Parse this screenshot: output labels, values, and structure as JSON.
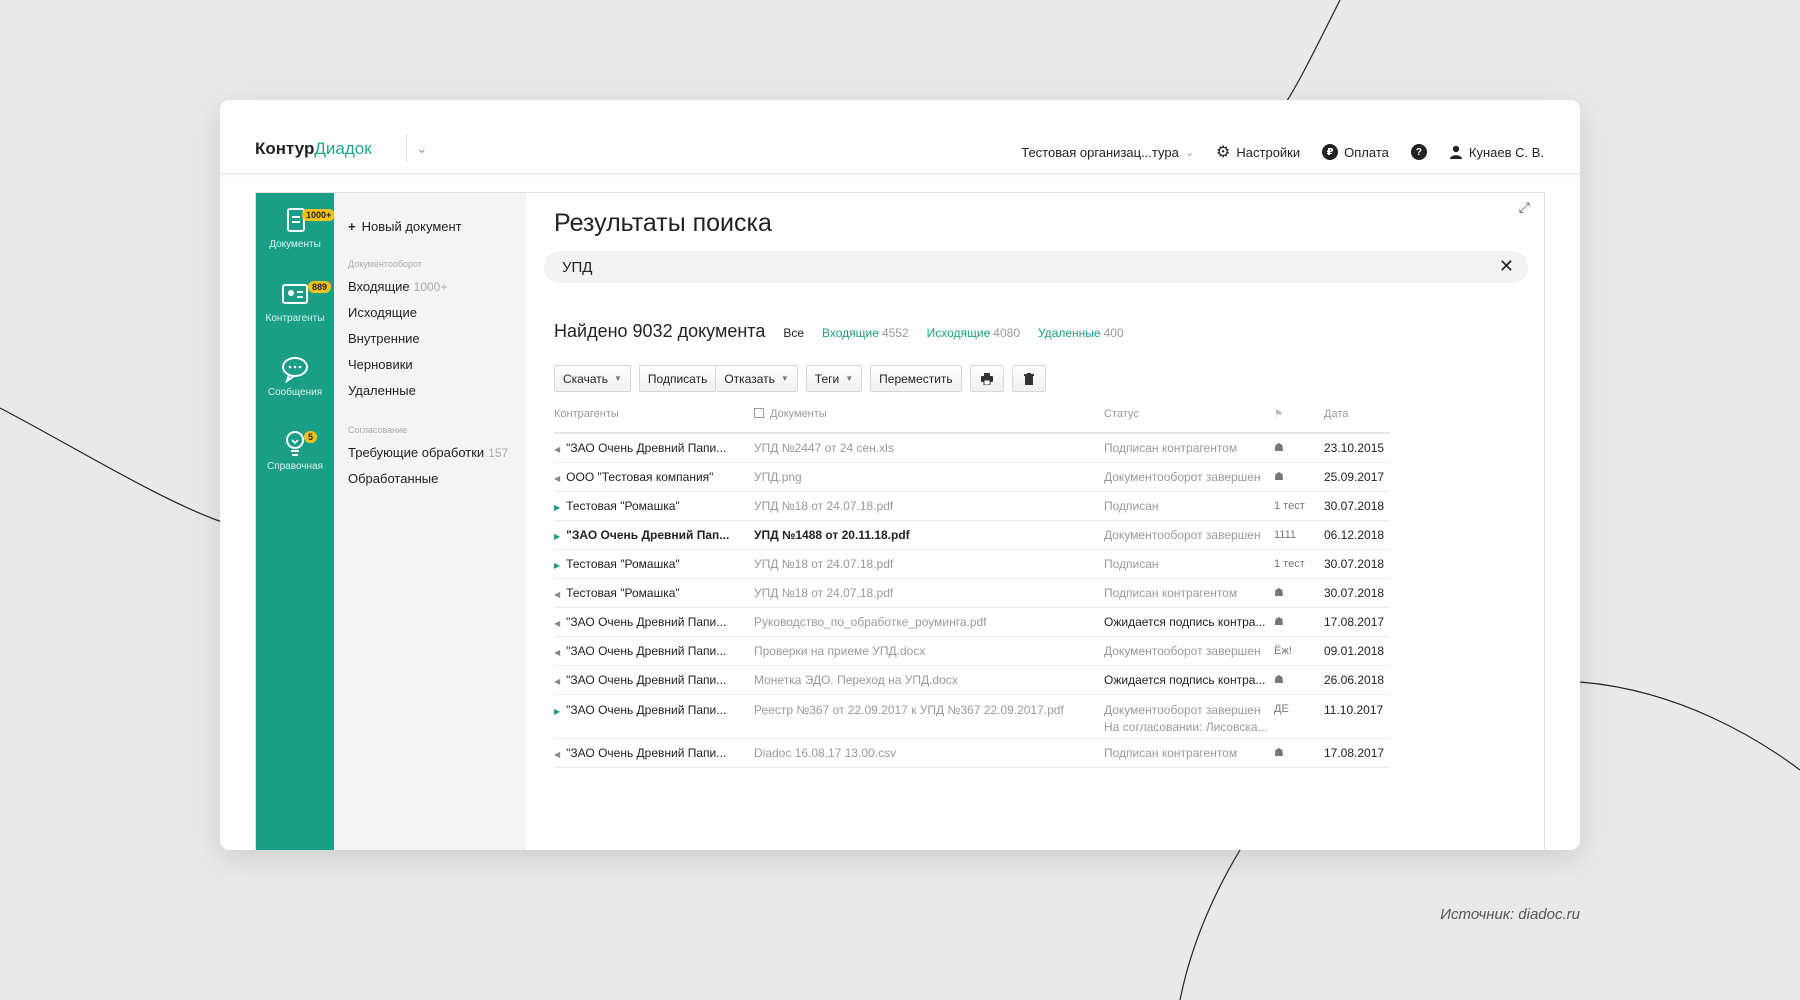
{
  "source_note": "Источник: diadoc.ru",
  "header": {
    "logo_part1": "Контур",
    "logo_part2": "Диадок",
    "organization": "Тестовая организац...тура",
    "settings": "Настройки",
    "payment": "Оплата",
    "help_glyph": "?",
    "user": "Кунаев С. В."
  },
  "rail": [
    {
      "label": "Документы",
      "badge": "1000+",
      "icon": "document-icon"
    },
    {
      "label": "Контрагенты",
      "badge": "889",
      "icon": "contacts-icon"
    },
    {
      "label": "Сообщения",
      "badge": "",
      "icon": "chat-icon"
    },
    {
      "label": "Справочная",
      "badge": "5",
      "icon": "lightbulb-icon"
    }
  ],
  "nav": {
    "new_document": "Новый документ",
    "section_docflow": "Документооборот",
    "items": [
      {
        "label": "Входящие",
        "count": "1000+"
      },
      {
        "label": "Исходящие",
        "count": ""
      },
      {
        "label": "Внутренние",
        "count": ""
      },
      {
        "label": "Черновики",
        "count": ""
      },
      {
        "label": "Удаленные",
        "count": ""
      }
    ],
    "section_approval": "Согласование",
    "approval_items": [
      {
        "label": "Требующие обработки",
        "count": "157"
      },
      {
        "label": "Обработанные",
        "count": ""
      }
    ]
  },
  "main": {
    "title": "Результаты поиска",
    "search_value": "УПД",
    "clear_glyph": "✕",
    "found": "Найдено 9032 документа",
    "filters": [
      {
        "label": "Все",
        "count": ""
      },
      {
        "label": "Входящие",
        "count": "4552"
      },
      {
        "label": "Исходящие",
        "count": "4080"
      },
      {
        "label": "Удаленные",
        "count": "400"
      }
    ],
    "toolbar": {
      "download": "Скачать",
      "sign": "Подписать",
      "reject": "Отказать",
      "tags": "Теги",
      "move": "Переместить",
      "print_icon": "printer-icon",
      "delete_icon": "trash-icon"
    },
    "columns": {
      "party": "Контрагенты",
      "docs": "Документы",
      "status": "Статус",
      "tags_icon": "tag-icon",
      "date": "Дата"
    },
    "rows": [
      {
        "party": "\"ЗАО Очень Древний Папи...",
        "doc": "УПД №2447 от 24 сен.xls",
        "status": "Подписан контрагентом",
        "tag": "☗",
        "date": "23.10.2015"
      },
      {
        "party": "ООО \"Тестовая компания\"",
        "doc": "УПД.png",
        "status": "Документооборот завершен",
        "tag": "☗",
        "date": "25.09.2017"
      },
      {
        "party": "Тестовая \"Ромашка\"",
        "doc": "УПД №18 от 24.07.18.pdf",
        "status": "Подписан",
        "tag": "1 тест",
        "date": "30.07.2018"
      },
      {
        "party": "\"ЗАО Очень Древний Пап...",
        "doc": "УПД №1488 от 20.11.18.pdf",
        "status": "Документооборот завершен",
        "tag": "1111",
        "date": "06.12.2018"
      },
      {
        "party": "Тестовая \"Ромашка\"",
        "doc": "УПД №18 от 24.07.18.pdf",
        "status": "Подписан",
        "tag": "1 тест",
        "date": "30.07.2018"
      },
      {
        "party": "Тестовая \"Ромашка\"",
        "doc": "УПД №18 от 24.07.18.pdf",
        "status": "Подписан контрагентом",
        "tag": "☗",
        "date": "30.07.2018"
      },
      {
        "party": "\"ЗАО Очень Древний Папи...",
        "doc": "Руководство_по_обработке_роуминга.pdf",
        "status": "Ожидается подпись контра...",
        "tag": "☗",
        "date": "17.08.2017"
      },
      {
        "party": "\"ЗАО Очень Древний Папи...",
        "doc": "Проверки на приеме УПД.docx",
        "status": "Документооборот завершен",
        "tag": "Ёж!",
        "date": "09.01.2018"
      },
      {
        "party": "\"ЗАО Очень Древний Папи...",
        "doc": "Монетка ЭДО. Переход на УПД.docx",
        "status": "Ожидается подпись контра...",
        "tag": "☗",
        "date": "26.06.2018"
      },
      {
        "party": "\"ЗАО Очень Древний Папи...",
        "doc": "Реестр №367 от 22.09.2017 к УПД №367 22.09.2017.pdf",
        "status": "Документооборот завершен",
        "status2": "На согласовании: Лисовска...",
        "tag": "ДЕ",
        "date": "11.10.2017"
      },
      {
        "party": "\"ЗАО Очень Древний Папи...",
        "doc": "Diadoc 16.08.17 13.00.csv",
        "status": "Подписан контрагентом",
        "tag": "☗",
        "date": "17.08.2017"
      }
    ]
  },
  "colors": {
    "accent": "#1b9e86",
    "badge": "#f5c21b",
    "background": "#e9e9e9"
  }
}
